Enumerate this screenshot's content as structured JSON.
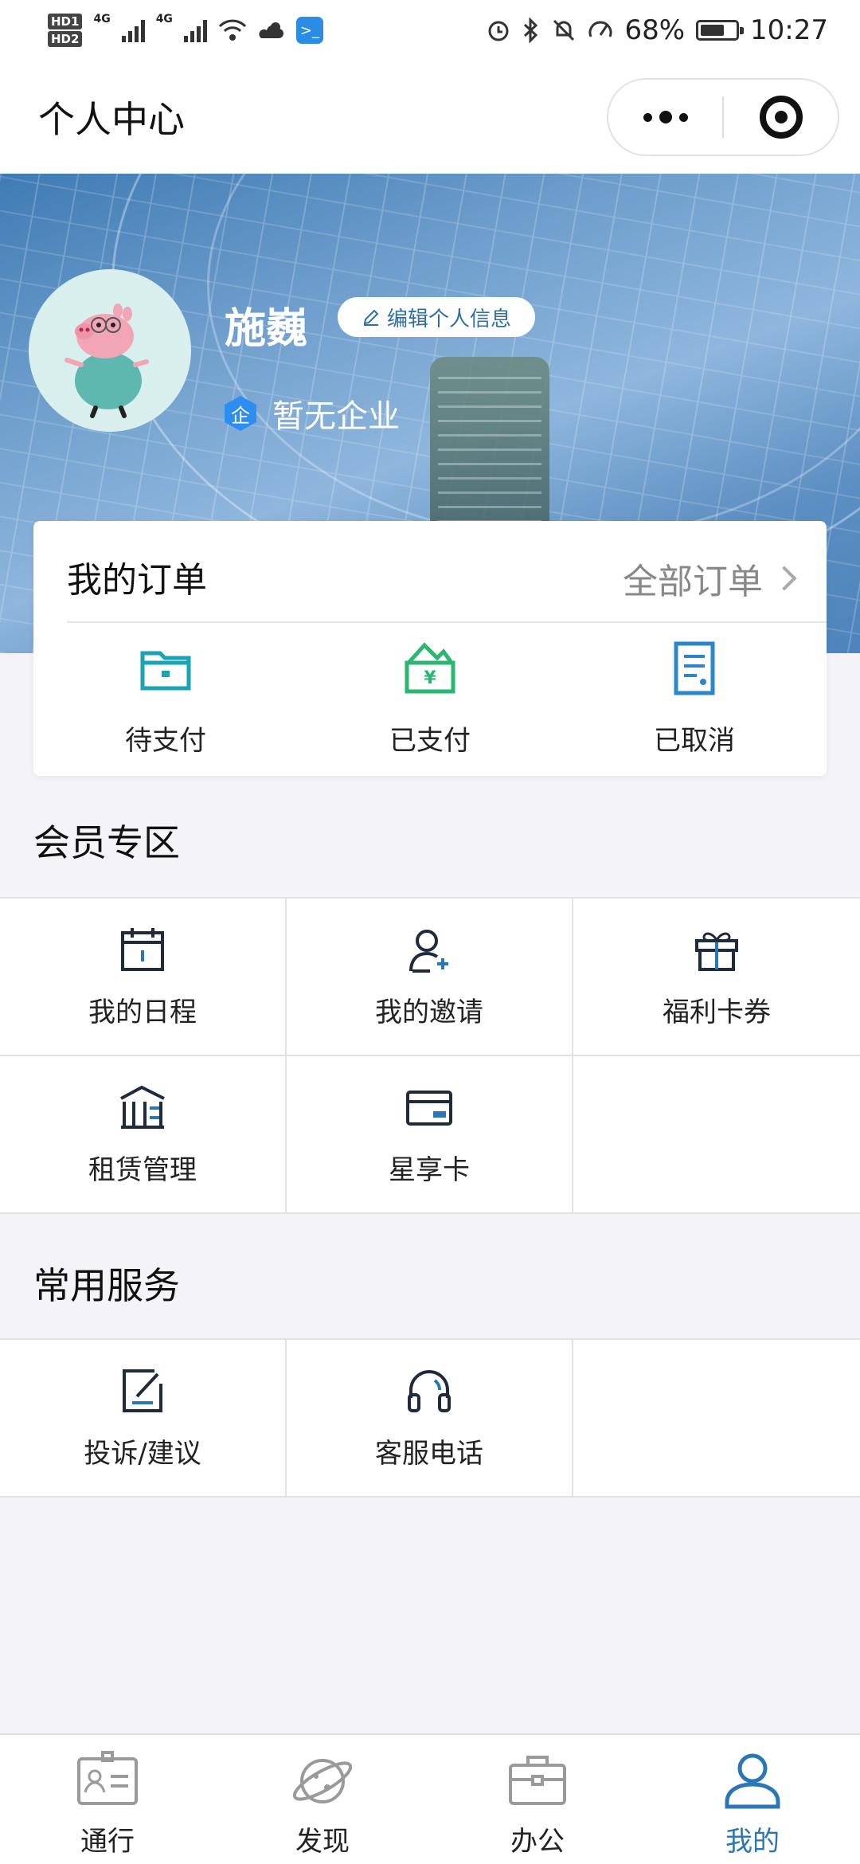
{
  "status_bar": {
    "hd1": "HD1",
    "hd2": "HD2",
    "net1": "4G",
    "net2": "4G",
    "battery": "68%",
    "battery_level": 0.68,
    "time": "10:27"
  },
  "title_bar": {
    "title": "个人中心"
  },
  "profile": {
    "username": "施巍",
    "edit_label": "编辑个人信息",
    "company_badge": "企",
    "company": "暂无企业"
  },
  "orders": {
    "title": "我的订单",
    "all_label": "全部订单",
    "items": [
      {
        "label": "待支付",
        "icon": "wallet-icon"
      },
      {
        "label": "已支付",
        "icon": "money-paid-icon"
      },
      {
        "label": "已取消",
        "icon": "document-cancel-icon"
      }
    ]
  },
  "member": {
    "title": "会员专区",
    "items": [
      {
        "label": "我的日程",
        "icon": "calendar-icon"
      },
      {
        "label": "我的邀请",
        "icon": "invite-user-icon"
      },
      {
        "label": "福利卡券",
        "icon": "gift-icon"
      },
      {
        "label": "租赁管理",
        "icon": "building-icon"
      },
      {
        "label": "星享卡",
        "icon": "card-icon"
      }
    ]
  },
  "services": {
    "title": "常用服务",
    "items": [
      {
        "label": "投诉/建议",
        "icon": "edit-feedback-icon"
      },
      {
        "label": "客服电话",
        "icon": "headset-icon"
      }
    ]
  },
  "tabbar": {
    "items": [
      {
        "label": "通行",
        "icon": "id-card-icon",
        "active": false
      },
      {
        "label": "发现",
        "icon": "planet-icon",
        "active": false
      },
      {
        "label": "办公",
        "icon": "briefcase-icon",
        "active": false
      },
      {
        "label": "我的",
        "icon": "user-icon",
        "active": true
      }
    ]
  },
  "colors": {
    "accent": "#2b76b7",
    "teal": "#1aa3b5",
    "green": "#2bb673",
    "background": "#f4f4f8"
  }
}
